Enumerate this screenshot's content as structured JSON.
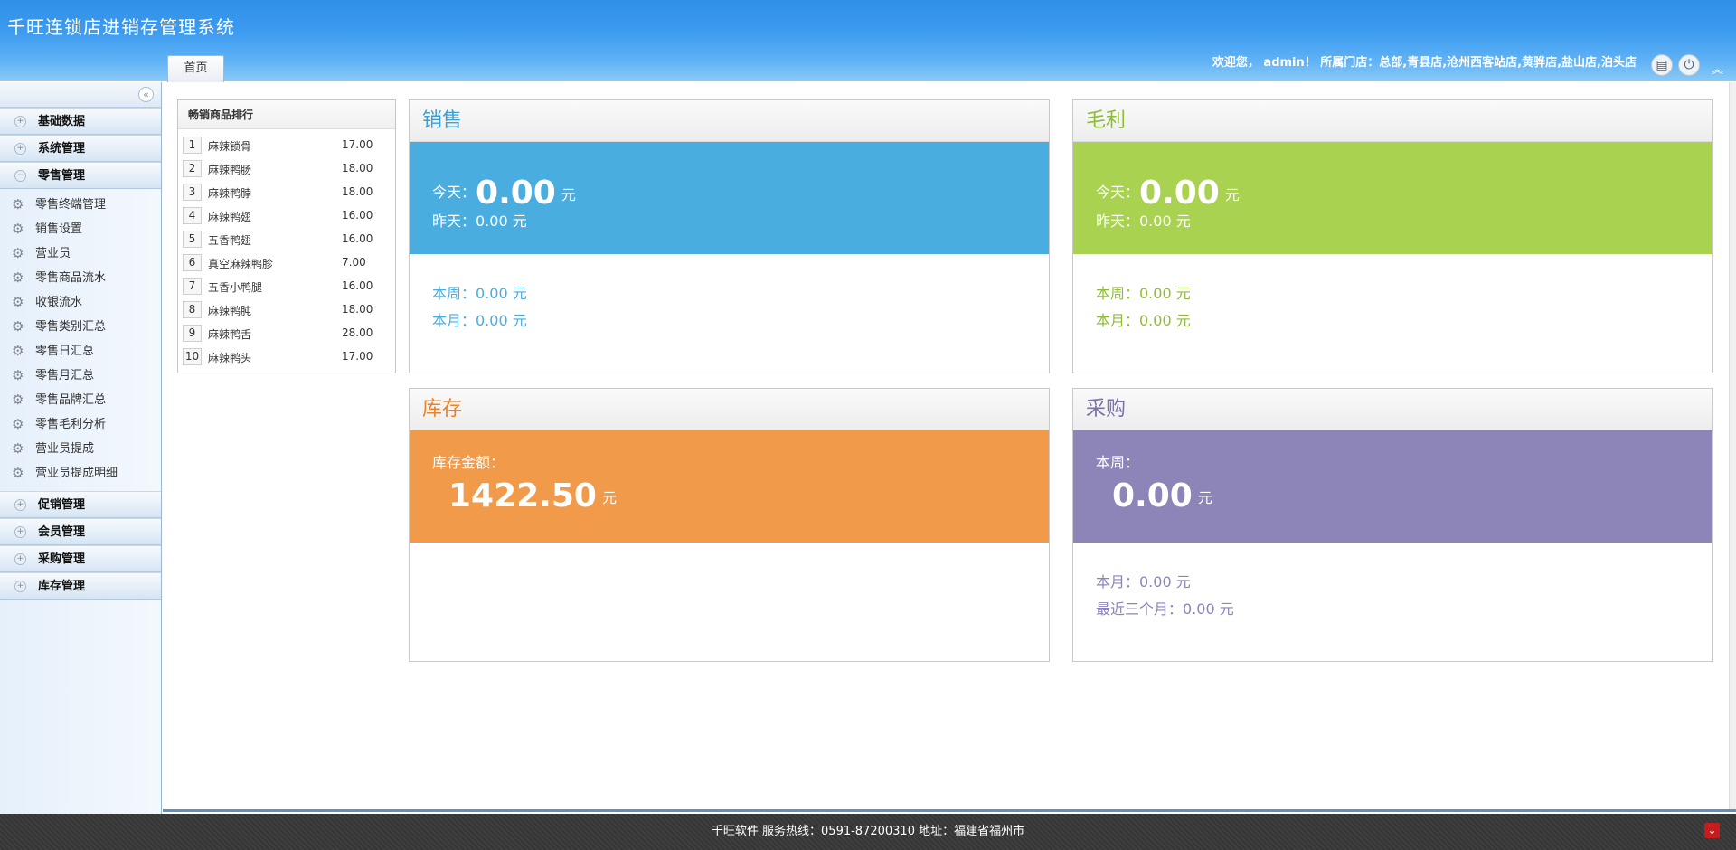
{
  "app": {
    "title": "千旺连锁店进销存管理系统"
  },
  "tabs": [
    {
      "label": "首页"
    }
  ],
  "header": {
    "welcome": "欢迎您， admin！ 所属门店：总部,青县店,沧州西客站店,黄骅店,盐山店,泊头店",
    "icons": [
      "clipboard-icon",
      "power-icon",
      "collapse-up-icon"
    ]
  },
  "sidebar": {
    "groups_top": [
      {
        "label": "基础数据"
      },
      {
        "label": "系统管理"
      },
      {
        "label": "零售管理"
      }
    ],
    "retail_items": [
      "零售终端管理",
      "销售设置",
      "营业员",
      "零售商品流水",
      "收银流水",
      "零售类别汇总",
      "零售日汇总",
      "零售月汇总",
      "零售品牌汇总",
      "零售毛利分析",
      "营业员提成",
      "营业员提成明细"
    ],
    "groups_bottom": [
      {
        "label": "促销管理"
      },
      {
        "label": "会员管理"
      },
      {
        "label": "采购管理"
      },
      {
        "label": "库存管理"
      }
    ]
  },
  "rank": {
    "title": "畅销商品排行",
    "rows": [
      {
        "n": "1",
        "name": "麻辣锁骨",
        "value": "17.00"
      },
      {
        "n": "2",
        "name": "麻辣鸭肠",
        "value": "18.00"
      },
      {
        "n": "3",
        "name": "麻辣鸭脖",
        "value": "18.00"
      },
      {
        "n": "4",
        "name": "麻辣鸭翅",
        "value": "16.00"
      },
      {
        "n": "5",
        "name": "五香鸭翅",
        "value": "16.00"
      },
      {
        "n": "6",
        "name": "真空麻辣鸭胗",
        "value": "7.00"
      },
      {
        "n": "7",
        "name": "五香小鸭腿",
        "value": "16.00"
      },
      {
        "n": "8",
        "name": "麻辣鸭肫",
        "value": "18.00"
      },
      {
        "n": "9",
        "name": "麻辣鸭舌",
        "value": "28.00"
      },
      {
        "n": "10",
        "name": "麻辣鸭头",
        "value": "17.00"
      }
    ]
  },
  "cards": {
    "sales": {
      "title": "销售",
      "today_label": "今天：",
      "today_value": "0.00",
      "unit": "元",
      "yesterday": "昨天：0.00 元",
      "week": "本周：0.00 元",
      "month": "本月：0.00 元",
      "color": "#49ade0",
      "title_color": "#3d9fd4"
    },
    "profit": {
      "title": "毛利",
      "today_label": "今天：",
      "today_value": "0.00",
      "unit": "元",
      "yesterday": "昨天：0.00 元",
      "week": "本周：0.00 元",
      "month": "本月：0.00 元",
      "color": "#a8d24f",
      "title_color": "#8fbc37"
    },
    "inventory": {
      "title": "库存",
      "amount_label": "库存金额：",
      "amount_value": "1422.50",
      "unit": "元",
      "color": "#f09a4a",
      "title_color": "#e7832a"
    },
    "purchase": {
      "title": "采购",
      "week_label": "本周：",
      "week_value": "0.00",
      "unit": "元",
      "month": "本月：0.00 元",
      "three_months": "最近三个月：0.00 元",
      "color": "#8d84b8",
      "title_color": "#7d73a9"
    }
  },
  "footer": {
    "text": "千旺软件 服务热线：0591-87200310 地址：福建省福州市"
  }
}
